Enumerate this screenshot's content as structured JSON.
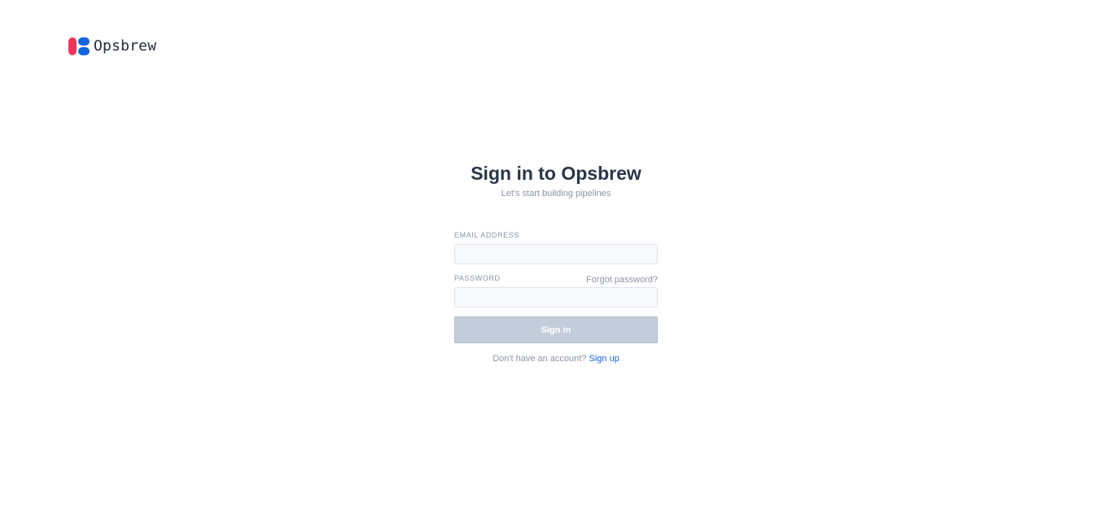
{
  "header": {
    "brand_name": "Opsbrew",
    "logo_colors": {
      "red": "#e8375a",
      "blue": "#1565d8"
    }
  },
  "auth": {
    "title": "Sign in to Opsbrew",
    "subtitle": "Let's start building pipelines",
    "email": {
      "label": "EMAIL ADDRESS",
      "value": "",
      "placeholder": ""
    },
    "password": {
      "label": "PASSWORD",
      "value": "",
      "placeholder": "",
      "forgot_label": "Forgot password?"
    },
    "submit_label": "Sign in",
    "signup_prompt": "Don't have an account?",
    "signup_link": "Sign up"
  },
  "colors": {
    "accent": "#1565d8",
    "button_disabled_bg": "#c3ccda",
    "text_muted": "#8a94a6",
    "text_dark": "#2a3547"
  }
}
